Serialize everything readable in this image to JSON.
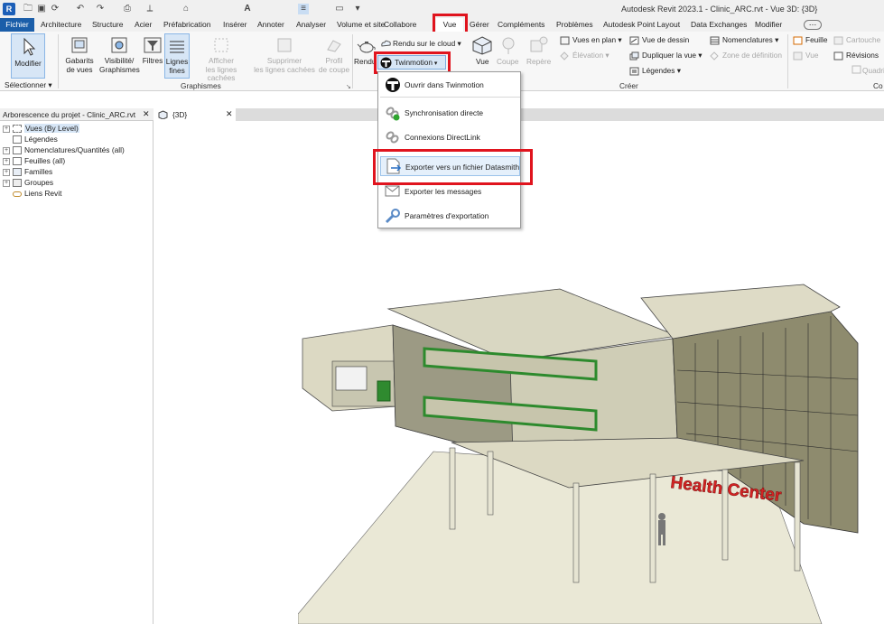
{
  "app": {
    "logo": "R",
    "window_title": "Autodesk Revit 2023.1 - Clinic_ARC.rvt - Vue 3D: {3D}"
  },
  "quick_access": [
    "open-icon",
    "save-icon",
    "sync-icon",
    "undo-icon",
    "redo-icon",
    "print-icon",
    "measure-icon",
    "tag-icon",
    "text-icon",
    "thin-lines-icon",
    "switch-windows-icon",
    "dropdown-icon"
  ],
  "menu": {
    "file": "Fichier",
    "items": [
      "Architecture",
      "Structure",
      "Acier",
      "Préfabrication",
      "Insérer",
      "Annoter",
      "Analyser",
      "Volume et site",
      "Collabore",
      "Vue",
      "Gérer",
      "Compléments",
      "Problèmes",
      "Autodesk Point Layout",
      "Data Exchanges",
      "Modifier"
    ]
  },
  "ribbon": {
    "modify": "Modifier",
    "select": "Sélectionner ▾",
    "templates": "Gabarits\nde vues",
    "visibility": "Visibilité/\nGraphismes",
    "filters": "Filtres",
    "thin_lines": "Lignes\nfines",
    "show_hidden": "Afficher\nles lignes cachées",
    "remove_hidden": "Supprimer\nles lignes cachées",
    "cut_profile": "Profil\nde coupe",
    "graphics_group": "Graphismes",
    "render": "Rendu",
    "cloud_render": "Rendu sur le cloud ▾",
    "twinmotion": "Twinmotion",
    "view3d": "Vue",
    "section": "Coupe",
    "callout": "Repère",
    "plan_views": "Vues en plan ▾",
    "elevation": "Élévation ▾",
    "drafting_view": "Vue de dessin",
    "duplicate_view": "Dupliquer la vue ▾",
    "legends": "Légendes ▾",
    "schedules": "Nomenclatures ▾",
    "scope_box": "Zone de définition",
    "create_group": "Créer",
    "sheet": "Feuille",
    "view_ref": "Vue",
    "titleblock": "Cartouche",
    "revisions": "Révisions",
    "matchline": "Quadrillage",
    "composition": "Co"
  },
  "twinmotion_menu": [
    {
      "label": "Ouvrir dans Twinmotion",
      "icon": "twinmotion-icon"
    },
    {
      "label": "Synchronisation directe",
      "icon": "sync-link-icon"
    },
    {
      "label": "Connexions DirectLink",
      "icon": "link-icon"
    },
    {
      "label": "Exporter vers un fichier Datasmith",
      "icon": "export-file-icon"
    },
    {
      "label": "Exporter les messages",
      "icon": "messages-icon"
    },
    {
      "label": "Paramètres d'exportation",
      "icon": "settings-wrench-icon"
    }
  ],
  "browser": {
    "title": "Arborescence du projet - Clinic_ARC.rvt",
    "close": "✕",
    "items": [
      "Vues (By Level)",
      "Légendes",
      "Nomenclatures/Quantités (all)",
      "Feuilles (all)",
      "Familles",
      "Groupes",
      "Liens Revit"
    ]
  },
  "view": {
    "tab": "{3D}",
    "close": "✕",
    "sign": "Health Center"
  },
  "colors": {
    "accent": "#1b5ea9",
    "highlight": "#e0141e",
    "menu_hover": "#d7e6f6"
  }
}
